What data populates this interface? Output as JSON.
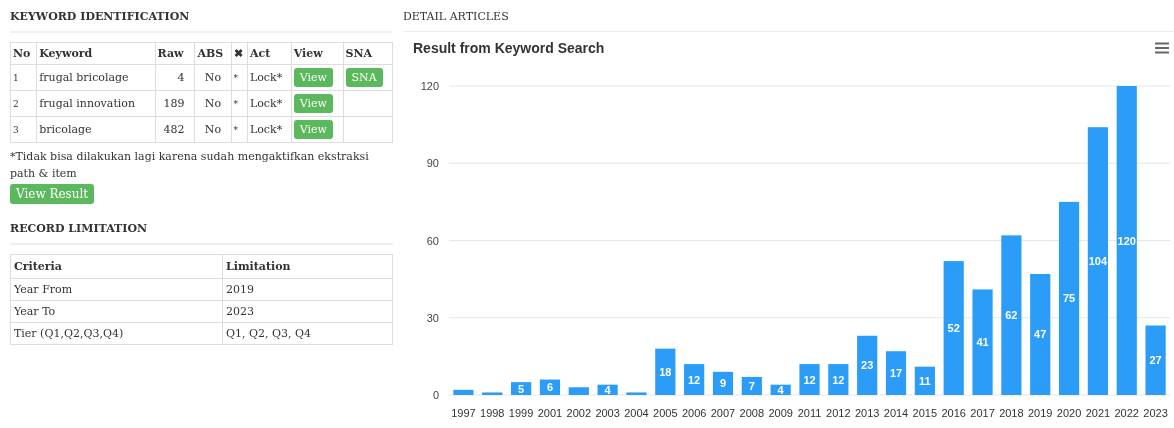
{
  "keyword_identification": {
    "title": "KEYWORD IDENTIFICATION",
    "columns": [
      "No",
      "Keyword",
      "Raw",
      "ABS",
      "✖",
      "Act",
      "View",
      "SNA"
    ],
    "rows": [
      {
        "no": "1",
        "keyword": "frugal bricolage",
        "raw": "4",
        "abs": "No",
        "mark": "*",
        "act": "Lock*",
        "view_button": "View",
        "sna_button": "SNA"
      },
      {
        "no": "2",
        "keyword": "frugal innovation",
        "raw": "189",
        "abs": "No",
        "mark": "*",
        "act": "Lock*",
        "view_button": "View"
      },
      {
        "no": "3",
        "keyword": "bricolage",
        "raw": "482",
        "abs": "No",
        "mark": "*",
        "act": "Lock*",
        "view_button": "View"
      }
    ],
    "note": "*Tidak bisa dilakukan lagi karena sudah mengaktifkan ekstraksi path & item",
    "view_result_button": "View Result"
  },
  "record_limitation": {
    "title": "RECORD LIMITATION",
    "columns": [
      "Criteria",
      "Limitation"
    ],
    "rows": [
      {
        "criteria": "Year From",
        "limitation": "2019"
      },
      {
        "criteria": "Year To",
        "limitation": "2023"
      },
      {
        "criteria": "Tier (Q1,Q2,Q3,Q4)",
        "limitation": "Q1, Q2, Q3, Q4"
      }
    ]
  },
  "detail_articles": {
    "title": "DETAIL ARTICLES",
    "chart_data": {
      "type": "bar",
      "title": "Result from Keyword Search",
      "categories": [
        "1997",
        "1998",
        "1999",
        "2001",
        "2002",
        "2003",
        "2004",
        "2005",
        "2006",
        "2007",
        "2008",
        "2009",
        "2011",
        "2012",
        "2013",
        "2014",
        "2015",
        "2016",
        "2017",
        "2018",
        "2019",
        "2020",
        "2021",
        "2022",
        "2023"
      ],
      "series": [
        {
          "color": "#2b9cf8",
          "values": [
            2,
            1,
            5,
            6,
            3,
            4,
            1,
            18,
            12,
            9,
            7,
            4,
            12,
            12,
            23,
            17,
            11,
            52,
            41,
            62,
            47,
            75,
            104,
            120,
            27
          ]
        }
      ],
      "ylim": [
        0,
        120
      ],
      "yticks": [
        0,
        30,
        60,
        90,
        120
      ],
      "value_labels": [
        null,
        null,
        "5",
        "6",
        null,
        "4",
        null,
        "18",
        "12",
        "9",
        "7",
        "4",
        "12",
        "12",
        "23",
        "17",
        "11",
        "52",
        "41",
        "62",
        "47",
        "75",
        "104",
        "120",
        "27"
      ],
      "grid": true
    }
  }
}
